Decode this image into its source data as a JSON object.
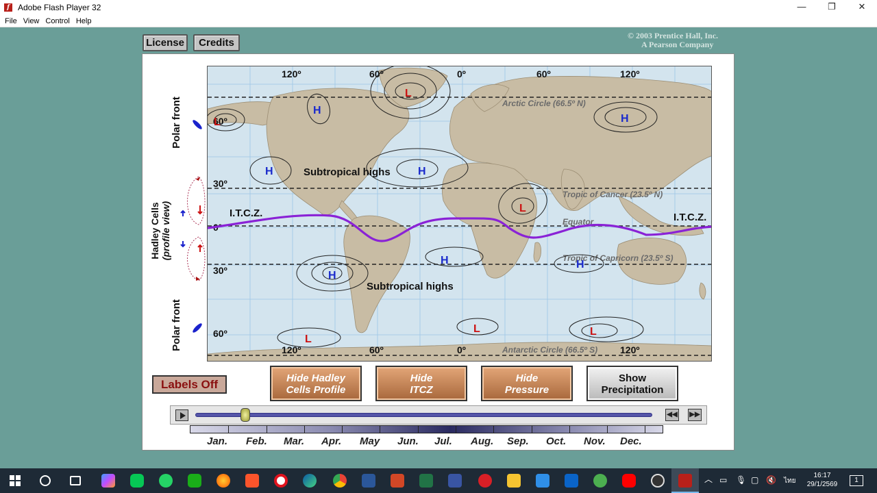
{
  "window": {
    "title": "Adobe Flash Player 32",
    "menu": [
      "File",
      "View",
      "Control",
      "Help"
    ]
  },
  "top_buttons": {
    "license": "License",
    "credits": "Credits"
  },
  "copyright": {
    "line1": "© 2003 Prentice Hall, Inc.",
    "line2": "A Pearson Company"
  },
  "side_labels": {
    "polar_front": "Polar front",
    "hadley_title": "Hadley Cells",
    "hadley_sub": "(profile view)"
  },
  "map": {
    "top_lon": [
      "120º",
      "60º",
      "0º",
      "60º",
      "120º"
    ],
    "bottom_lon": [
      "120º",
      "60º",
      "0º",
      "120º"
    ],
    "lat_left": [
      "60º",
      "30º",
      "0º",
      "30º",
      "60º"
    ],
    "circles": {
      "arctic": "Arctic Circle (66.5º N)",
      "cancer": "Tropic of Cancer (23.5º N)",
      "equator": "Equator",
      "capricorn": "Tropic of Capricorn (23.5º S)",
      "antarctic": "Antarctic Circle (66.5º S)"
    },
    "itcz_left": "I.T.C.Z.",
    "itcz_right": "I.T.C.Z.",
    "subtropical_north": "Subtropical highs",
    "subtropical_south": "Subtropical highs",
    "high": "H",
    "low": "L",
    "colors": {
      "ocean": "#d3e4ee",
      "land": "#c8bca4",
      "itcz": "#8a22d6",
      "high": "#1a2acc",
      "low": "#cc1111"
    }
  },
  "controls": {
    "labels_toggle": "Labels Off",
    "hide_hadley": [
      "Hide Hadley",
      "Cells Profile"
    ],
    "hide_itcz": [
      "Hide",
      "ITCZ"
    ],
    "hide_pressure": [
      "Hide",
      "Pressure"
    ],
    "show_precip": [
      "Show",
      "Precipitation"
    ],
    "rewind": "◀◀",
    "forward": "▶▶",
    "month_position": 0.11
  },
  "months": [
    "Jan.",
    "Feb.",
    "Mar.",
    "Apr.",
    "May",
    "Jun.",
    "Jul.",
    "Aug.",
    "Sep.",
    "Oct.",
    "Nov.",
    "Dec."
  ],
  "taskbar": {
    "time": "16:17",
    "date": "29/1/2569",
    "lang": "ไทย",
    "notif": "1"
  }
}
